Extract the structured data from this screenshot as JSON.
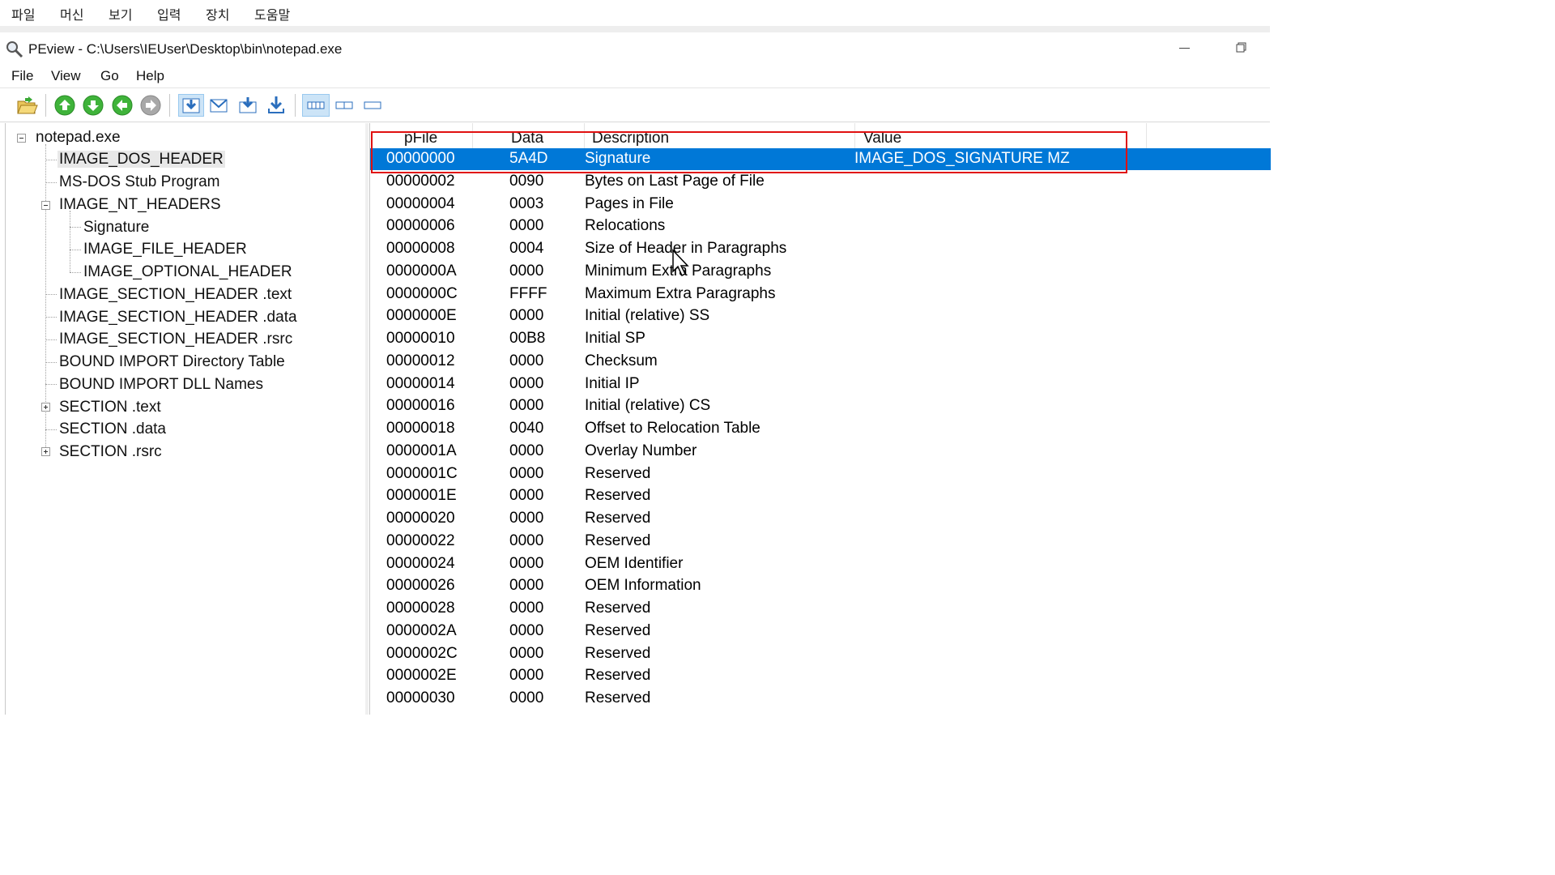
{
  "vm_menu": [
    "파일",
    "머신",
    "보기",
    "입력",
    "장치",
    "도움말"
  ],
  "window": {
    "title": "PEview - C:\\Users\\IEUser\\Desktop\\bin\\notepad.exe"
  },
  "app_menu": [
    "File",
    "View",
    "Go",
    "Help"
  ],
  "toolbar": {
    "icons": [
      "open-folder-icon",
      "up-arrow-icon",
      "down-arrow-icon",
      "back-arrow-icon",
      "forward-arrow-icon",
      "view-download-icon",
      "view-mail-icon",
      "view-export-icon",
      "view-import-icon",
      "view-wide-icon",
      "view-medium-icon",
      "view-narrow-icon"
    ],
    "selected_view": "view-wide-icon"
  },
  "tree": [
    {
      "label": "notepad.exe",
      "depth": 0,
      "expander": "minus"
    },
    {
      "label": "IMAGE_DOS_HEADER",
      "depth": 1,
      "selected": true
    },
    {
      "label": "MS-DOS Stub Program",
      "depth": 1
    },
    {
      "label": "IMAGE_NT_HEADERS",
      "depth": 1,
      "expander": "minus"
    },
    {
      "label": "Signature",
      "depth": 2
    },
    {
      "label": "IMAGE_FILE_HEADER",
      "depth": 2
    },
    {
      "label": "IMAGE_OPTIONAL_HEADER",
      "depth": 2
    },
    {
      "label": "IMAGE_SECTION_HEADER .text",
      "depth": 1
    },
    {
      "label": "IMAGE_SECTION_HEADER .data",
      "depth": 1
    },
    {
      "label": "IMAGE_SECTION_HEADER .rsrc",
      "depth": 1
    },
    {
      "label": "BOUND IMPORT Directory Table",
      "depth": 1
    },
    {
      "label": "BOUND IMPORT DLL Names",
      "depth": 1
    },
    {
      "label": "SECTION .text",
      "depth": 1,
      "expander": "plus"
    },
    {
      "label": "SECTION .data",
      "depth": 1
    },
    {
      "label": "SECTION .rsrc",
      "depth": 1,
      "expander": "plus"
    }
  ],
  "list": {
    "columns": [
      "pFile",
      "Data",
      "Description",
      "Value"
    ],
    "rows": [
      [
        "00000000",
        "5A4D",
        "Signature",
        "IMAGE_DOS_SIGNATURE  MZ"
      ],
      [
        "00000002",
        "0090",
        "Bytes on Last Page of File",
        ""
      ],
      [
        "00000004",
        "0003",
        "Pages in File",
        ""
      ],
      [
        "00000006",
        "0000",
        "Relocations",
        ""
      ],
      [
        "00000008",
        "0004",
        "Size of Header in Paragraphs",
        ""
      ],
      [
        "0000000A",
        "0000",
        "Minimum Extra Paragraphs",
        ""
      ],
      [
        "0000000C",
        "FFFF",
        "Maximum Extra Paragraphs",
        ""
      ],
      [
        "0000000E",
        "0000",
        "Initial (relative) SS",
        ""
      ],
      [
        "00000010",
        "00B8",
        "Initial SP",
        ""
      ],
      [
        "00000012",
        "0000",
        "Checksum",
        ""
      ],
      [
        "00000014",
        "0000",
        "Initial IP",
        ""
      ],
      [
        "00000016",
        "0000",
        "Initial (relative) CS",
        ""
      ],
      [
        "00000018",
        "0040",
        "Offset to Relocation Table",
        ""
      ],
      [
        "0000001A",
        "0000",
        "Overlay Number",
        ""
      ],
      [
        "0000001C",
        "0000",
        "Reserved",
        ""
      ],
      [
        "0000001E",
        "0000",
        "Reserved",
        ""
      ],
      [
        "00000020",
        "0000",
        "Reserved",
        ""
      ],
      [
        "00000022",
        "0000",
        "Reserved",
        ""
      ],
      [
        "00000024",
        "0000",
        "OEM Identifier",
        ""
      ],
      [
        "00000026",
        "0000",
        "OEM Information",
        ""
      ],
      [
        "00000028",
        "0000",
        "Reserved",
        ""
      ],
      [
        "0000002A",
        "0000",
        "Reserved",
        ""
      ],
      [
        "0000002C",
        "0000",
        "Reserved",
        ""
      ],
      [
        "0000002E",
        "0000",
        "Reserved",
        ""
      ],
      [
        "00000030",
        "0000",
        "Reserved",
        ""
      ]
    ],
    "selected_row": 0
  },
  "colors": {
    "selection": "#0078d7",
    "highlight_box": "#e01010"
  }
}
